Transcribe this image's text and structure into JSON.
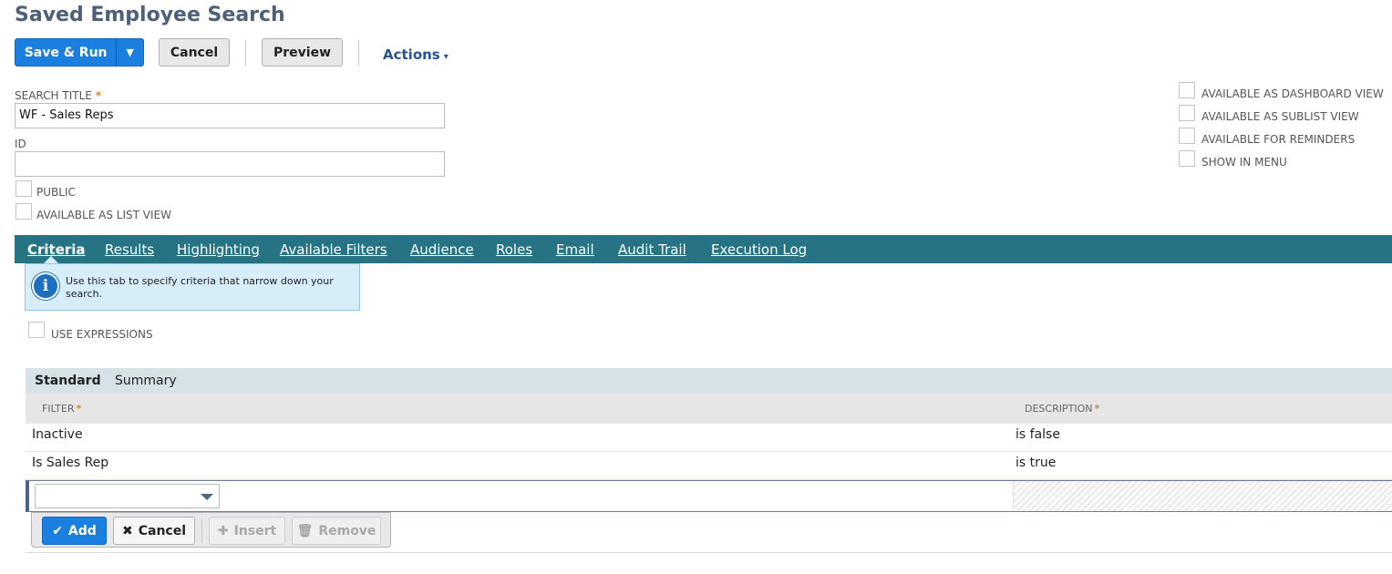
{
  "page": {
    "title": "Saved Employee Search"
  },
  "toolbar": {
    "save_run_label": "Save & Run",
    "save_run_arrow": "▼",
    "cancel_label": "Cancel",
    "preview_label": "Preview",
    "actions_label": "Actions",
    "actions_caret": "▾"
  },
  "form": {
    "search_title_label": "SEARCH TITLE",
    "required_marker": "*",
    "search_title_value": "WF - Sales Reps",
    "id_label": "ID",
    "id_value": "",
    "left_checkboxes": [
      {
        "label": "PUBLIC",
        "checked": false
      },
      {
        "label": "AVAILABLE AS LIST VIEW",
        "checked": false
      }
    ],
    "right_checkboxes": [
      {
        "label": "AVAILABLE AS DASHBOARD VIEW",
        "checked": false
      },
      {
        "label": "AVAILABLE AS SUBLIST VIEW",
        "checked": false
      },
      {
        "label": "AVAILABLE FOR REMINDERS",
        "checked": false
      },
      {
        "label": "SHOW IN MENU",
        "checked": false
      }
    ]
  },
  "tabs": [
    {
      "label": "Criteria",
      "active": true
    },
    {
      "label": "Results",
      "active": false
    },
    {
      "label": "Highlighting",
      "active": false
    },
    {
      "label": "Available Filters",
      "active": false
    },
    {
      "label": "Audience",
      "active": false
    },
    {
      "label": "Roles",
      "active": false
    },
    {
      "label": "Email",
      "active": false
    },
    {
      "label": "Audit Trail",
      "active": false
    },
    {
      "label": "Execution Log",
      "active": false
    }
  ],
  "info": {
    "icon": "info-icon",
    "icon_glyph": "i",
    "text": "Use this tab to specify criteria that narrow down your search."
  },
  "criteria": {
    "use_expressions_label": "USE EXPRESSIONS",
    "use_expressions_checked": false,
    "subtabs": [
      {
        "label": "Standard",
        "active": true
      },
      {
        "label": "Summary",
        "active": false
      }
    ],
    "columns": {
      "filter": "FILTER",
      "description": "DESCRIPTION",
      "required_marker": "*"
    },
    "rows": [
      {
        "filter": "Inactive",
        "description": "is false"
      },
      {
        "filter": "Is Sales Rep",
        "description": "is true"
      }
    ],
    "edit_row": {
      "filter_value": ""
    },
    "machine_buttons": {
      "add_label": "Add",
      "cancel_label": "Cancel",
      "insert_label": "Insert",
      "remove_label": "Remove"
    }
  },
  "colors": {
    "tab_bar": "#267483",
    "primary_button": "#1b7fe0",
    "title_text": "#4d5f79",
    "required": "#d08a1e",
    "info_background": "#d7eef9"
  }
}
